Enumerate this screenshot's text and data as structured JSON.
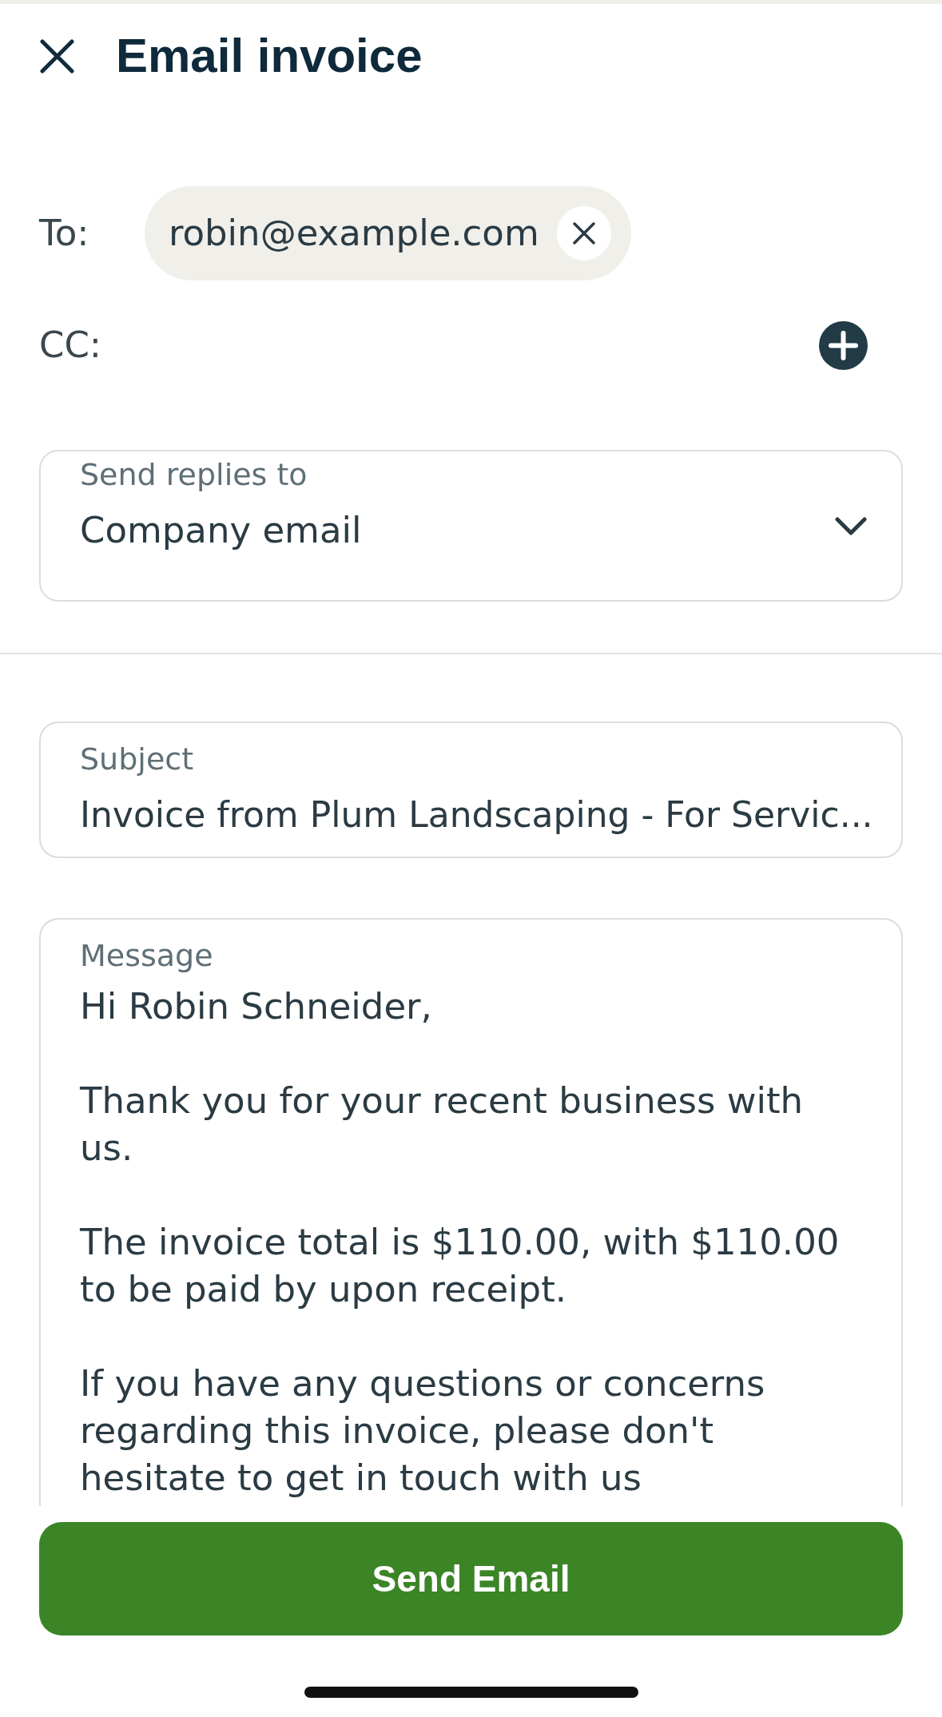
{
  "header": {
    "title": "Email invoice"
  },
  "recipients": {
    "to": {
      "label": "To:",
      "chips": [
        {
          "email": "robin@example.com"
        }
      ]
    },
    "cc": {
      "label": "CC:"
    }
  },
  "reply_to": {
    "label": "Send replies to",
    "value": "Company email"
  },
  "subject": {
    "label": "Subject",
    "value": "Invoice from Plum Landscaping - For Servic..."
  },
  "message": {
    "label": "Message",
    "paragraphs": [
      "Hi Robin Schneider,",
      "Thank you for your recent business with us.",
      "The invoice total is $110.00, with $110.00 to be paid by upon receipt.",
      "If you have any questions or concerns regarding this invoice, please don't hesitate to get in touch with us"
    ]
  },
  "actions": {
    "primary": "Send Email"
  }
}
